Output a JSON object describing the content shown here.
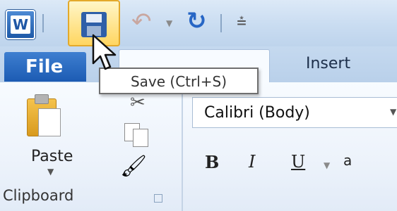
{
  "quick_access": {
    "app_icon": "word-icon",
    "app_letter": "W",
    "save_icon": "save-disk-icon",
    "undo_icon": "undo-icon",
    "redo_icon": "redo-icon",
    "customize_icon": "customize-qat-icon"
  },
  "tooltip": {
    "text": "Save (Ctrl+S)"
  },
  "tabs": [
    {
      "label": "File"
    },
    {
      "label": ""
    },
    {
      "label": "Insert"
    }
  ],
  "clipboard": {
    "paste_label": "Paste",
    "group_label": "Clipboard",
    "icons": [
      "paste-icon",
      "cut-icon",
      "copy-icon",
      "format-painter-icon"
    ]
  },
  "font": {
    "font_name": "Calibri (Body)",
    "bold_label": "B",
    "italic_label": "I",
    "underline_label": "U",
    "more_label": "a"
  },
  "colors": {
    "accent": "#1c5bb3",
    "highlight": "#ffd661"
  }
}
